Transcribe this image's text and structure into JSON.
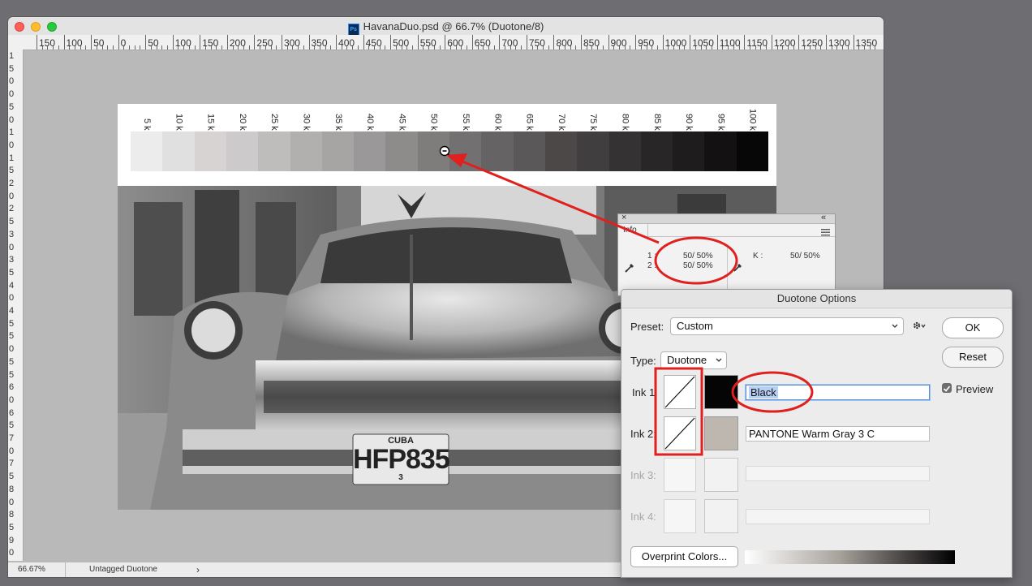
{
  "window": {
    "title": "HavanaDuo.psd @ 66.7% (Duotone/8)",
    "app_icon_text": "Ps",
    "ruler_h_labels": [
      "150",
      "100",
      "50",
      "0",
      "50",
      "100",
      "150",
      "200",
      "250",
      "300",
      "350",
      "400",
      "450",
      "500",
      "550",
      "600",
      "650",
      "700",
      "750",
      "800",
      "850",
      "900",
      "950",
      "1000",
      "1050",
      "1100",
      "1150",
      "1200",
      "1250",
      "1300",
      "1350"
    ],
    "ruler_v_labels": [
      "1",
      "5",
      "0",
      "0",
      "5",
      "0",
      "1",
      "0",
      "1",
      "5",
      "2",
      "0",
      "2",
      "5",
      "3",
      "0",
      "3",
      "5",
      "4",
      "0",
      "4",
      "5",
      "5",
      "0",
      "5",
      "5",
      "6",
      "0",
      "6",
      "5",
      "7",
      "0",
      "7",
      "5",
      "8",
      "0",
      "8",
      "5",
      "9",
      "0"
    ],
    "status_zoom": "66.67%",
    "status_profile": "Untagged Duotone",
    "status_arrow": "›"
  },
  "document": {
    "step_labels": [
      "5 k",
      "10 k",
      "15 k",
      "20 k",
      "25 k",
      "30 k",
      "35 k",
      "40 k",
      "45 k",
      "50 k",
      "55 k",
      "60 k",
      "65 k",
      "70 k",
      "75 k",
      "80 k",
      "85 k",
      "90 k",
      "95 k",
      "100 k"
    ],
    "step_colors": [
      "#ececec",
      "#e0e0e0",
      "#d6d3d2",
      "#cccaca",
      "#bfbdbc",
      "#b2b0af",
      "#a7a5a4",
      "#9a9898",
      "#8e8c8b",
      "#7f7d7c",
      "#727070",
      "#656363",
      "#5a5858",
      "#4c4848",
      "#403e3e",
      "#343232",
      "#282626",
      "#1e1c1c",
      "#131111",
      "#070707"
    ],
    "plate_top": "CUBA",
    "plate_main": "HFP835",
    "plate_bottom": "3",
    "annotation_color": "#e0201e"
  },
  "info_panel": {
    "title": "Info",
    "close": "×",
    "collapse": "«",
    "ch1_label": "1 :",
    "ch1_value": "50/  50%",
    "ch2_label": "2 :",
    "ch2_value": "50/  50%",
    "k_label": "K :",
    "k_value": "50/  50%"
  },
  "duotone_dialog": {
    "title": "Duotone Options",
    "preset_label": "Preset:",
    "preset_value": "Custom",
    "type_label": "Type:",
    "type_value": "Duotone",
    "ok": "OK",
    "reset": "Reset",
    "preview_label": "Preview",
    "preview_checked": true,
    "inks": [
      {
        "label": "Ink 1:",
        "name": "Black",
        "color": "#050505"
      },
      {
        "label": "Ink 2:",
        "name": "PANTONE Warm Gray 3 C",
        "color": "#beb7b0"
      },
      {
        "label": "Ink 3:",
        "name": "",
        "color": "#f2f2f2"
      },
      {
        "label": "Ink 4:",
        "name": "",
        "color": "#f2f2f2"
      }
    ],
    "overprint_button": "Overprint Colors..."
  }
}
